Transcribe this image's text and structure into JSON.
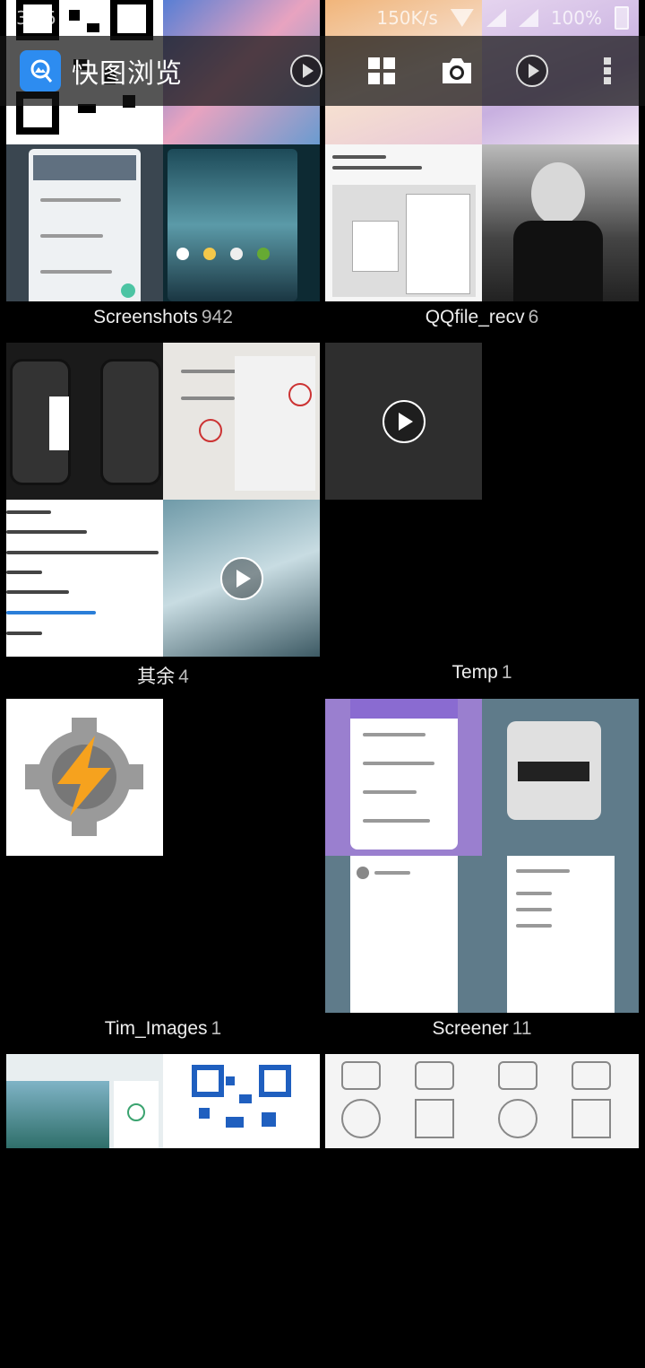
{
  "status_bar": {
    "time": "3:55",
    "speed": "150K/s",
    "battery": "100%"
  },
  "app_bar": {
    "title": "快图浏览",
    "icons": [
      "image-logo-icon",
      "slideshow-icon",
      "grid-view-icon",
      "camera-icon",
      "play-icon",
      "more-vert-icon"
    ]
  },
  "albums": [
    {
      "name": "Screenshots",
      "count": "942"
    },
    {
      "name": "QQfile_recv",
      "count": "6"
    },
    {
      "name": "其余",
      "count": "4"
    },
    {
      "name": "Temp",
      "count": "1"
    },
    {
      "name": "Tim_Images",
      "count": "1"
    },
    {
      "name": "Screener",
      "count": "11"
    }
  ],
  "colors": {
    "background": "#000000",
    "appbar": "#141414",
    "logo": "#2d8cf0",
    "apex_purple": "#8a6bd1",
    "slate": "#5f7b8a"
  }
}
